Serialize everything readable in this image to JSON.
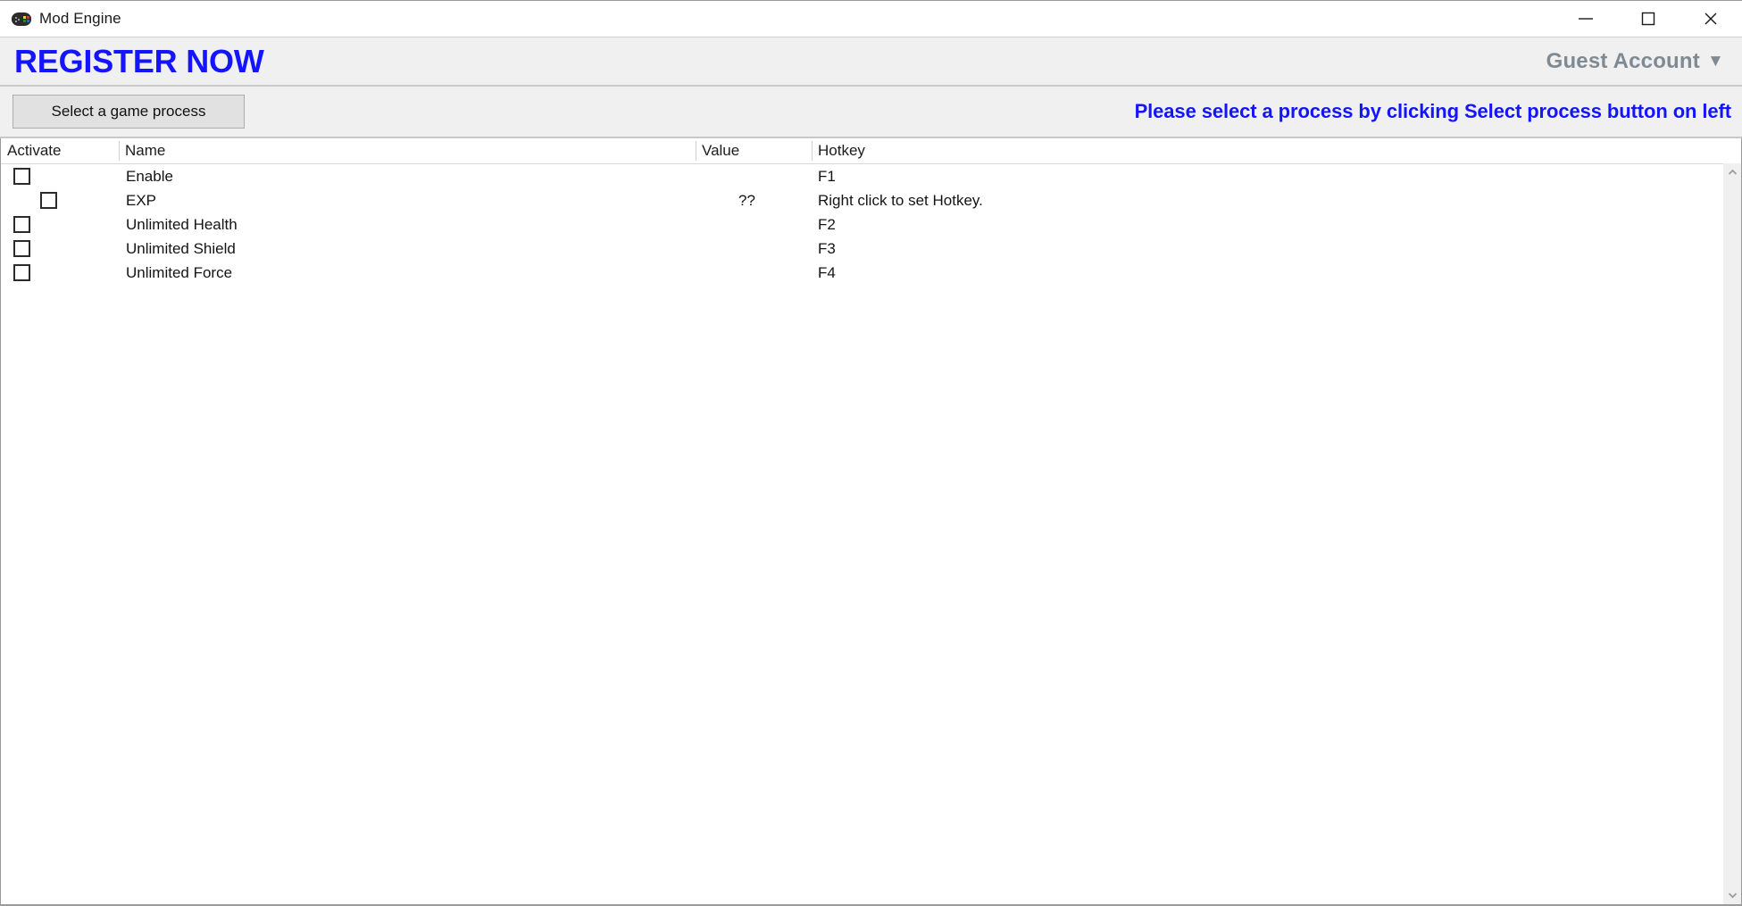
{
  "window": {
    "title": "Mod Engine",
    "icon": "gamepad-icon",
    "controls": {
      "minimize": "minimize-icon",
      "maximize": "maximize-icon",
      "close": "close-icon"
    }
  },
  "banner": {
    "register_label": "REGISTER NOW",
    "account_label": "Guest Account",
    "account_caret": "▼",
    "register_color": "#1414ff",
    "account_color": "#808a92",
    "background": "#f0f0f0"
  },
  "toolbar": {
    "select_process_label": "Select a game process",
    "notice": "Please select a process by clicking Select process button on left",
    "notice_color": "#1414ff"
  },
  "table": {
    "columns": [
      "Activate",
      "Name",
      "Value",
      "Hotkey"
    ],
    "rows": [
      {
        "indent": false,
        "name": "Enable",
        "value": "",
        "hotkey": "F1"
      },
      {
        "indent": true,
        "name": "EXP",
        "value": "??",
        "hotkey": "Right click to set Hotkey."
      },
      {
        "indent": false,
        "name": "Unlimited Health",
        "value": "",
        "hotkey": "F2"
      },
      {
        "indent": false,
        "name": "Unlimited Shield",
        "value": "",
        "hotkey": "F3"
      },
      {
        "indent": false,
        "name": "Unlimited Force",
        "value": "",
        "hotkey": "F4"
      }
    ]
  },
  "scrollbar": {
    "up_arrow": "chevron-up-icon",
    "down_arrow": "chevron-down-icon"
  }
}
